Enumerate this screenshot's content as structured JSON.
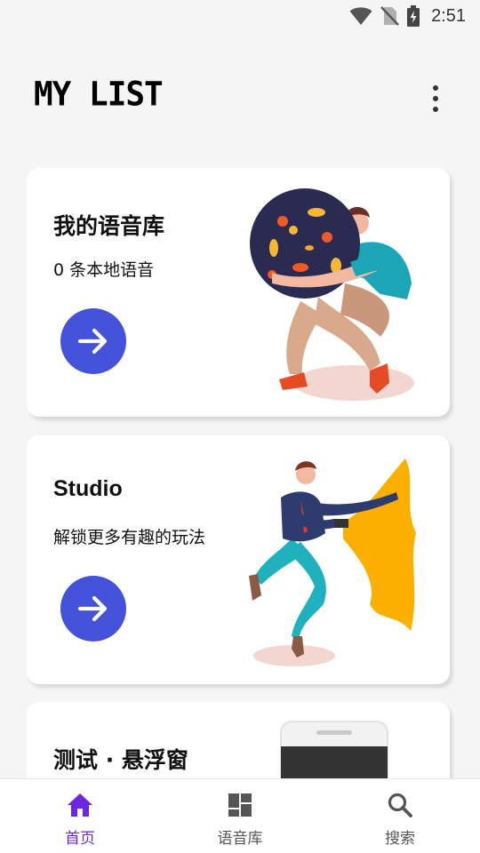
{
  "status_bar": {
    "time": "2:51",
    "icons": [
      "wifi-icon",
      "no-sim-icon",
      "battery-charging-icon"
    ]
  },
  "header": {
    "title": "MY LIST",
    "menu_icon": "more-vert-icon"
  },
  "cards": [
    {
      "title": "我的语音库",
      "subtitle": "0 条本地语音",
      "action_icon": "arrow-right-icon"
    },
    {
      "title": "Studio",
      "subtitle": "解锁更多有趣的玩法",
      "action_icon": "arrow-right-icon"
    },
    {
      "title": "测试 · 悬浮窗"
    }
  ],
  "bottom_nav": {
    "items": [
      {
        "label": "首页",
        "icon": "home-icon",
        "active": true
      },
      {
        "label": "语音库",
        "icon": "dashboard-icon",
        "active": false
      },
      {
        "label": "搜索",
        "icon": "search-icon",
        "active": false
      }
    ]
  },
  "colors": {
    "accent": "#4352d8",
    "nav_active": "#6a28e0",
    "background": "#f5f5f5"
  }
}
